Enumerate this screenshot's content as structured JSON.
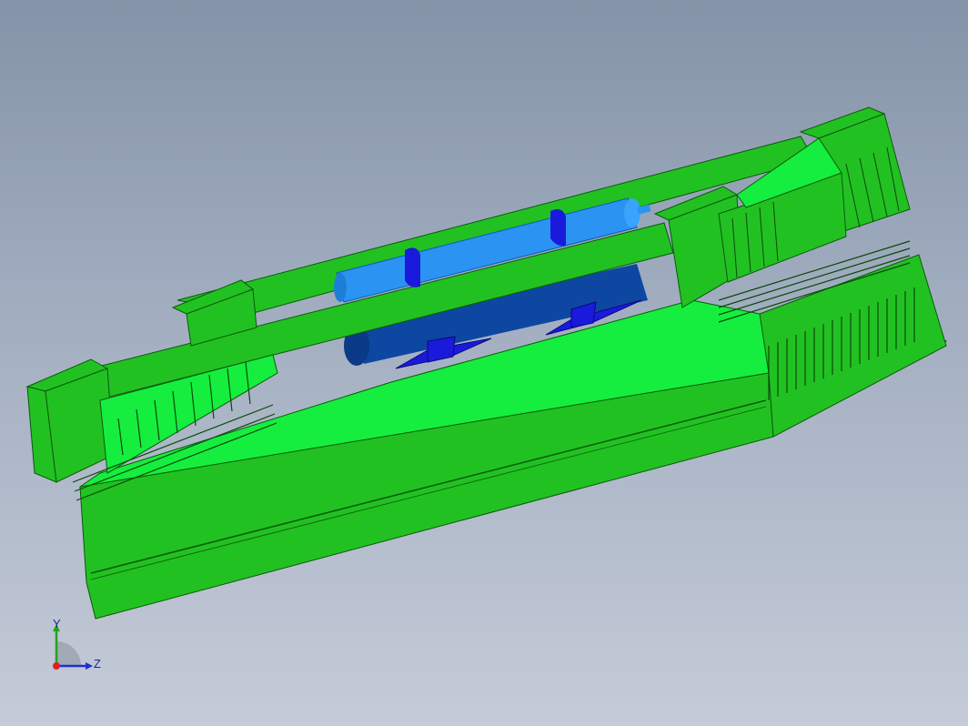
{
  "viewport": {
    "background_top": "#8593a8",
    "background_bottom": "#c5cbd8"
  },
  "model": {
    "frame_color": "#22c122",
    "deck_color": "#15ee3e",
    "vessel_color": "#2b94f2",
    "vessel_dark_color": "#0d47a1",
    "saddle_color": "#1a1adc"
  },
  "triad": {
    "y_label": "Y",
    "z_label": "Z",
    "y_color": "#1fa51f",
    "z_color": "#1e2fd0",
    "x_color": "#e02020"
  }
}
